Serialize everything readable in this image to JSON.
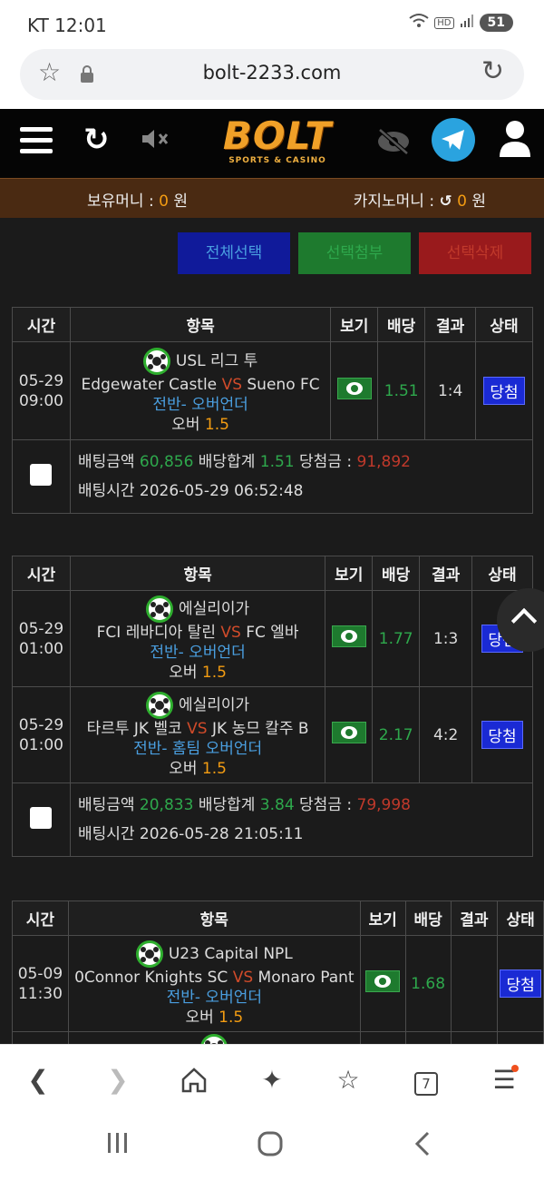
{
  "status": {
    "carrier_time": "KT 12:01",
    "battery": "51"
  },
  "browser": {
    "url": "bolt-2233.com",
    "tabs_count": "7"
  },
  "site": {
    "logo": "BOLT",
    "logo_sub": "SPORTS & CASINO"
  },
  "balance": {
    "money_label": "보유머니 :",
    "money_value": "0",
    "money_unit": "원",
    "casino_label": "카지노머니 :",
    "casino_value": "0",
    "casino_unit": "원"
  },
  "actions": {
    "select_all": "전체선택",
    "attach": "선택첨부",
    "delete": "선택삭제"
  },
  "headers": {
    "time": "시간",
    "item": "항목",
    "view": "보기",
    "odds": "배당",
    "result": "결과",
    "status": "상태"
  },
  "summary_labels": {
    "amount": "배팅금액",
    "total": "배당합계",
    "win": "당첨금 :",
    "bettime": "배팅시간"
  },
  "bets": [
    {
      "rows": [
        {
          "date": "05-29",
          "time": "09:00",
          "league": "USL 리그 투",
          "home": "Edgewater Castle",
          "vs": "VS",
          "away": "Sueno FC",
          "market": "전반- 오버언더",
          "pick": "오버",
          "line": "1.5",
          "odds": "1.51",
          "result": "1:4",
          "status": "당첨"
        }
      ],
      "amount": "60,856",
      "total": "1.51",
      "win": "91,892",
      "bettime": "2026-05-29 06:52:48"
    },
    {
      "rows": [
        {
          "date": "05-29",
          "time": "01:00",
          "league": "에실리이가",
          "home": "FCI 레바디아 탈린",
          "vs": "VS",
          "away": "FC 엘바",
          "market": "전반- 오버언더",
          "pick": "오버",
          "line": "1.5",
          "odds": "1.77",
          "result": "1:3",
          "status": "당첨"
        },
        {
          "date": "05-29",
          "time": "01:00",
          "league": "에실리이가",
          "home": "타르투 JK 벨코",
          "vs": "VS",
          "away": "JK 농므 칼주 B",
          "market": "전반- 홈팀 오버언더",
          "pick": "오버",
          "line": "1.5",
          "odds": "2.17",
          "result": "4:2",
          "status": "당첨"
        }
      ],
      "amount": "20,833",
      "total": "3.84",
      "win": "79,998",
      "bettime": "2026-05-28 21:05:11"
    },
    {
      "rows": [
        {
          "date": "05-09",
          "time": "11:30",
          "league": "U23 Capital NPL",
          "home": "0Connor Knights SC",
          "vs": "VS",
          "away": "Monaro Pant",
          "market": "전반- 오버언더",
          "pick": "오버",
          "line": "1.5",
          "odds": "1.68",
          "result": "",
          "status": "당첨"
        }
      ]
    }
  ]
}
